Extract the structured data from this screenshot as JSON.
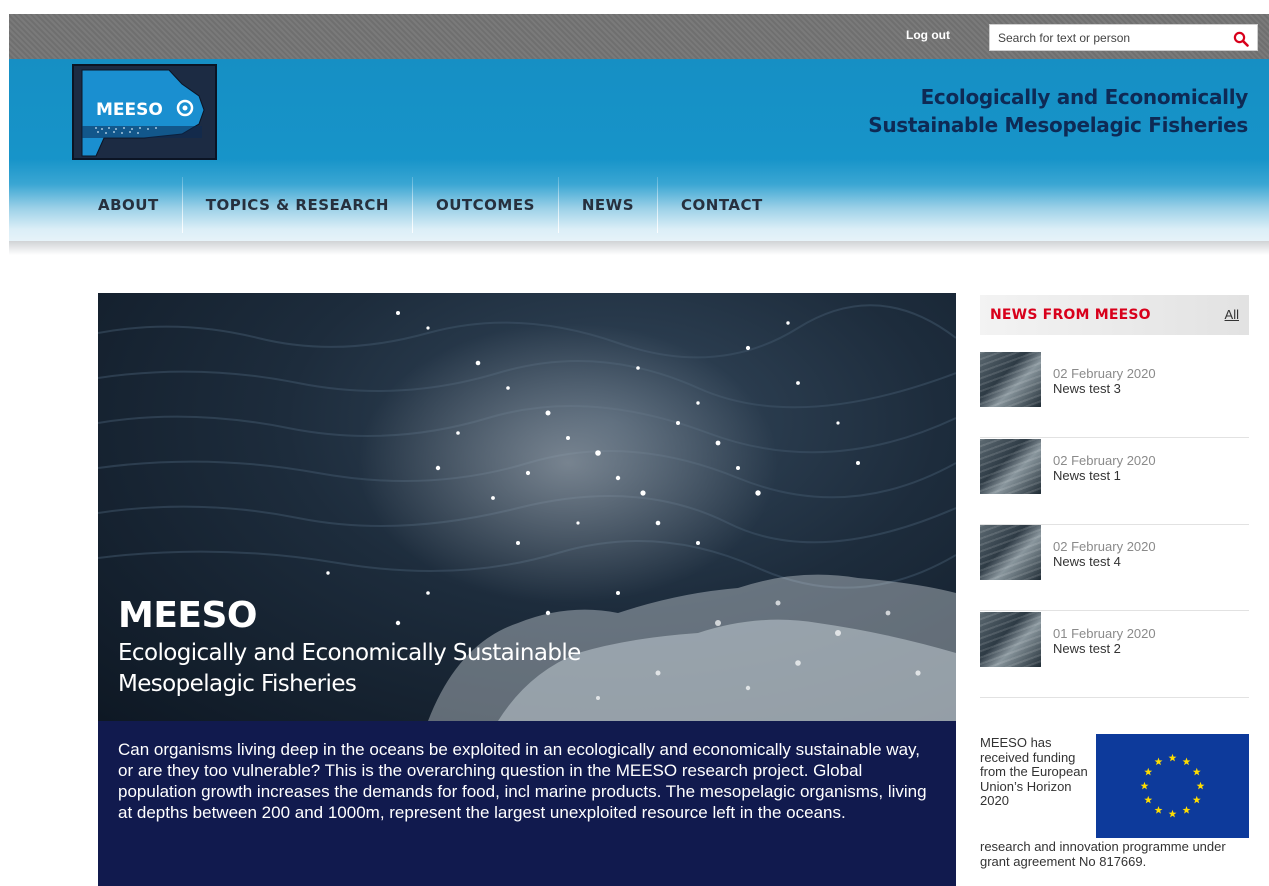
{
  "topbar": {
    "logout_label": "Log out",
    "search_placeholder": "Search for text or person",
    "search_icon": "search-icon"
  },
  "header": {
    "logo_text": "MEESO",
    "tagline_line1": "Ecologically and Economically",
    "tagline_line2": "Sustainable Mesopelagic Fisheries"
  },
  "nav": {
    "items": [
      {
        "label": "ABOUT"
      },
      {
        "label": "TOPICS & RESEARCH"
      },
      {
        "label": "OUTCOMES"
      },
      {
        "label": "NEWS"
      },
      {
        "label": "CONTACT"
      }
    ]
  },
  "hero": {
    "title": "MEESO",
    "subtitle_line1": "Ecologically and Economically Sustainable",
    "subtitle_line2": "Mesopelagic Fisheries"
  },
  "intro": {
    "text": "Can organisms living deep in the oceans be exploited in an ecologically and economically sustainable way, or are they too vulnerable? This is the overarching question in the MEESO research project. Global population growth increases the demands for food, incl marine products. The mesopelagic organisms, living at depths between 200 and 1000m, represent the largest unexploited resource left in the oceans."
  },
  "news": {
    "heading": "NEWS FROM MEESO",
    "all_label": "All",
    "items": [
      {
        "date": "02 February 2020",
        "title": "News test 3"
      },
      {
        "date": "02 February 2020",
        "title": "News test 1"
      },
      {
        "date": "02 February 2020",
        "title": "News test 4"
      },
      {
        "date": "01 February 2020",
        "title": "News test 2"
      }
    ]
  },
  "funding": {
    "text_part1": "MEESO has received funding from the European Union’s Horizon 2020",
    "text_part2": "research and innovation programme under grant agreement No 817669."
  },
  "colors": {
    "header_blue": "#1794c9",
    "news_red": "#d8001b",
    "intro_navy": "#111a4e",
    "eu_blue": "#0d3a9b",
    "eu_star": "#ffdd00"
  }
}
